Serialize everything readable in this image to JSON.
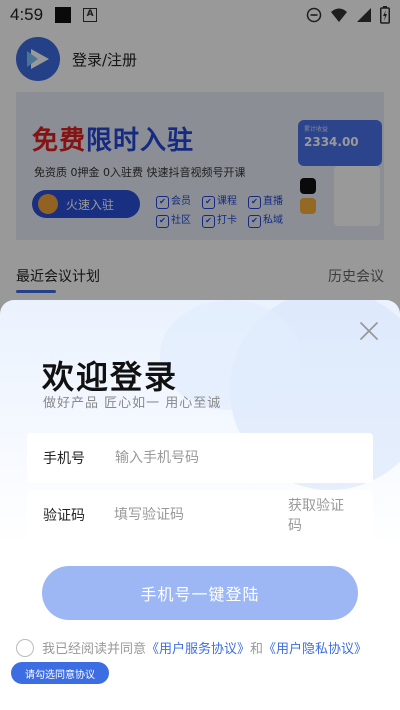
{
  "status_bar": {
    "time": "4:59",
    "icons": [
      "black-square-icon",
      "a-notification-icon",
      "do-not-disturb-icon",
      "wifi-icon",
      "signal-icon",
      "battery-charging-icon"
    ]
  },
  "header": {
    "title": "登录/注册"
  },
  "banner": {
    "title_red": "免费",
    "title_blue": "限时入驻",
    "subtitle": "免资质  0押金  0入驻费  快速抖音视频号开课",
    "button_label": "火速入驻",
    "features": [
      "会员",
      "课程",
      "直播",
      "社区",
      "打卡",
      "私域"
    ],
    "card_label": "累计收益",
    "card_value": "2334.00"
  },
  "tabs": {
    "recent": "最近会议计划",
    "history": "历史会议"
  },
  "login": {
    "title": "欢迎登录",
    "slogan": "做好产品 匠心如一 用心至诚",
    "phone_label": "手机号",
    "phone_placeholder": "输入手机号码",
    "code_label": "验证码",
    "code_placeholder": "填写验证码",
    "get_code": "获取验证码",
    "submit": "手机号一键登陆",
    "agree_prefix": "我已经阅读并同意",
    "service_link": "《用户服务协议》",
    "and": "和",
    "privacy_link": "《用户隐私协议》",
    "tip": "请勾选同意协议"
  },
  "colors": {
    "accent": "#3d6de3",
    "button_disabled": "#9db7f5",
    "banner_red": "#e02020",
    "banner_blue": "#2347d6"
  }
}
